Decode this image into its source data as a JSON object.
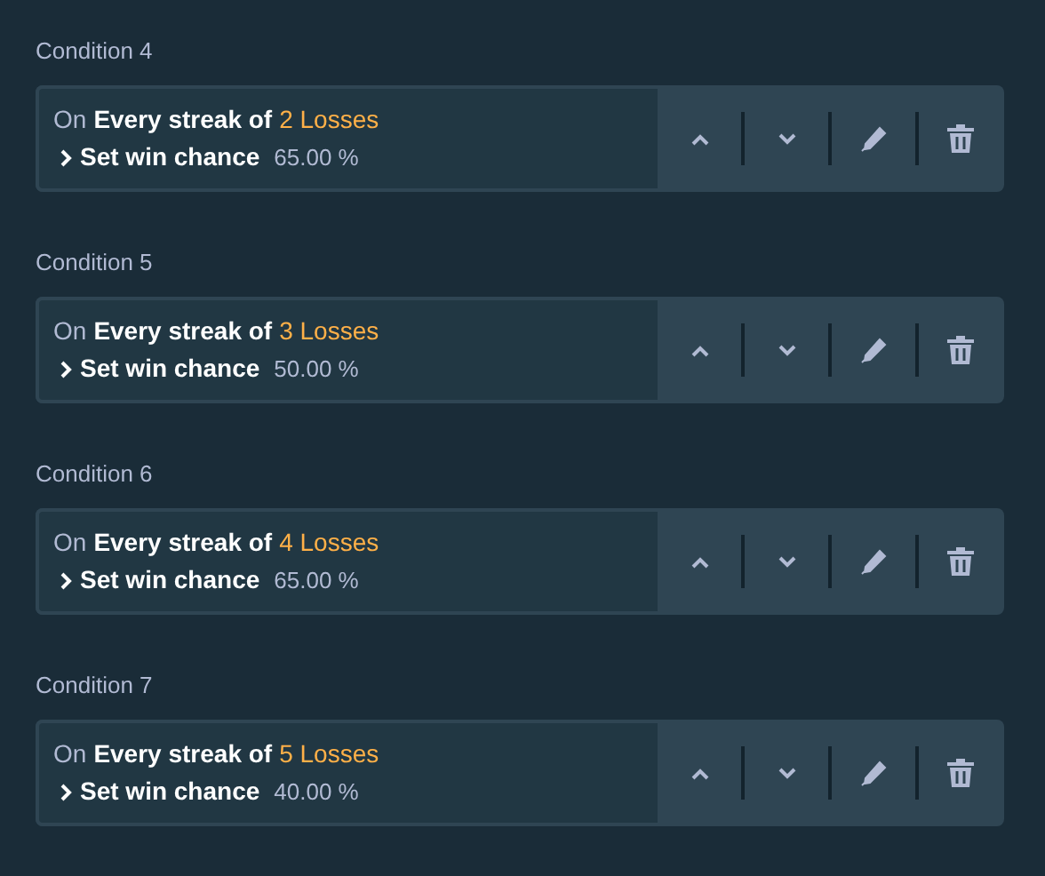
{
  "conditions": [
    {
      "title": "Condition 4",
      "prefix": "On",
      "trigger": "Every streak of",
      "value": "2 Losses",
      "action": "Set win chance",
      "amount": "65.00 %"
    },
    {
      "title": "Condition 5",
      "prefix": "On",
      "trigger": "Every streak of",
      "value": "3 Losses",
      "action": "Set win chance",
      "amount": "50.00 %"
    },
    {
      "title": "Condition 6",
      "prefix": "On",
      "trigger": "Every streak of",
      "value": "4 Losses",
      "action": "Set win chance",
      "amount": "65.00 %"
    },
    {
      "title": "Condition 7",
      "prefix": "On",
      "trigger": "Every streak of",
      "value": "5 Losses",
      "action": "Set win chance",
      "amount": "40.00 %"
    }
  ]
}
